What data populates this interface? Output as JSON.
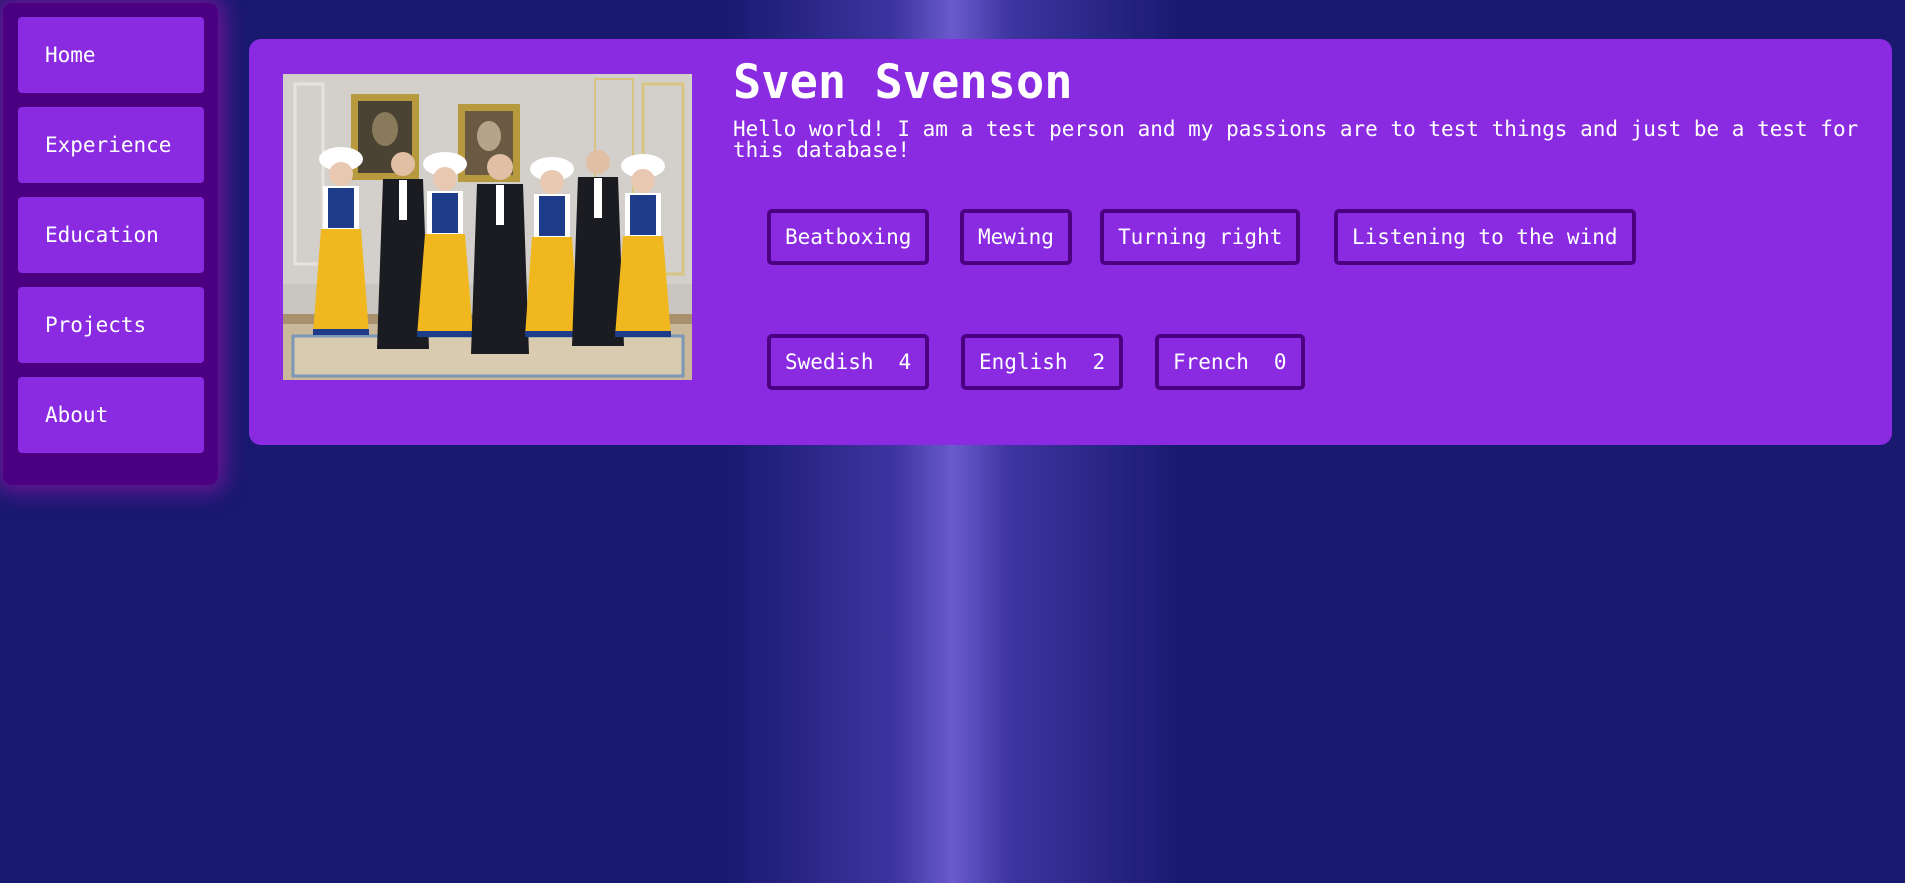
{
  "nav": {
    "items": [
      {
        "label": "Home"
      },
      {
        "label": "Experience"
      },
      {
        "label": "Education"
      },
      {
        "label": "Projects"
      },
      {
        "label": "About"
      }
    ]
  },
  "profile": {
    "name": "Sven Svenson",
    "bio": "Hello world! I am a test person and my passions are to test things and just be a test for this database!",
    "photo_description": "Group photo of seven people in a palace room"
  },
  "hobbies": [
    {
      "label": "Beatboxing"
    },
    {
      "label": "Mewing"
    },
    {
      "label": "Turning right"
    },
    {
      "label": "Listening to the wind"
    }
  ],
  "languages": [
    {
      "name": "Swedish",
      "level": "4"
    },
    {
      "name": "English",
      "level": "2"
    },
    {
      "name": "French",
      "level": "0"
    }
  ],
  "colors": {
    "background": "#191970",
    "background_highlight": "#6a5acd",
    "sidebar": "#4b0082",
    "accent": "#8a2be2",
    "tag_border": "#4b0082",
    "text": "#ffffff"
  }
}
